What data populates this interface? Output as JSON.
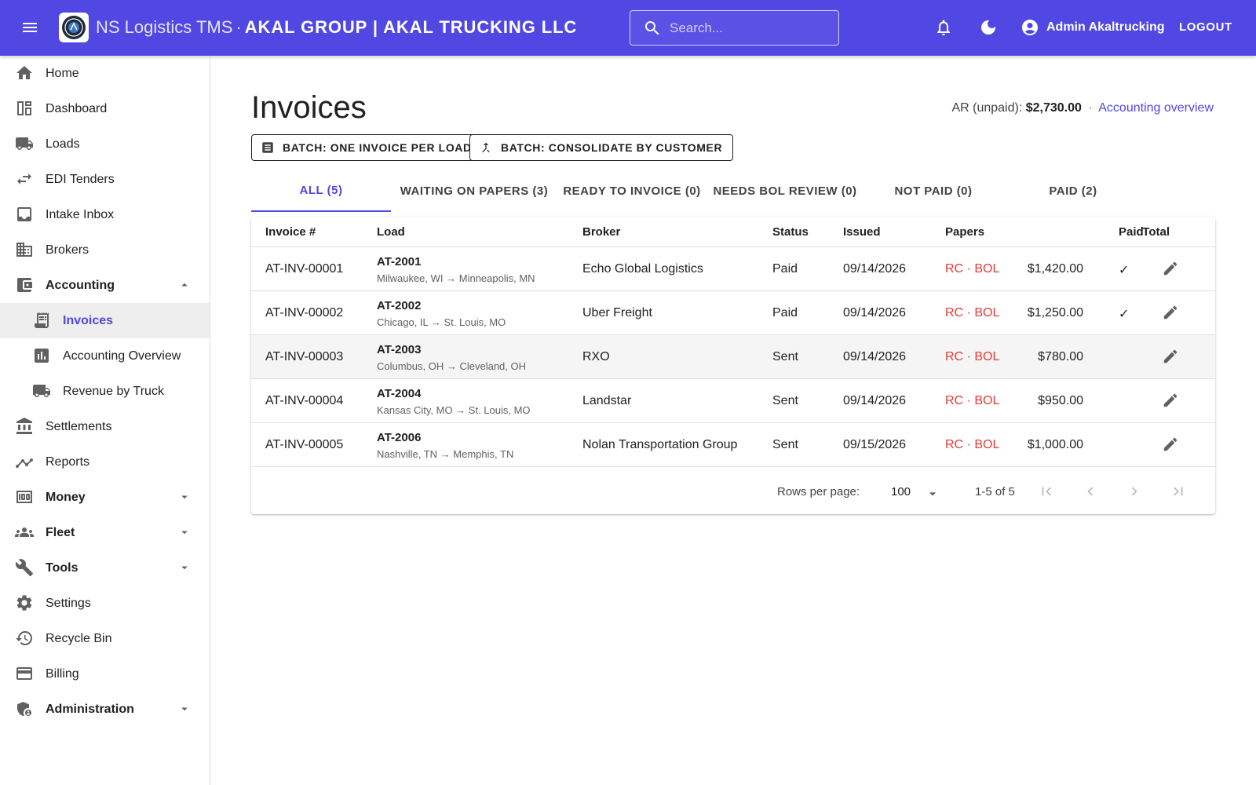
{
  "header": {
    "product": "NS Logistics TMS",
    "separator": "·",
    "company": "AKAL GROUP | AKAL TRUCKING LLC",
    "search_placeholder": "Search...",
    "user_name": "Admin Akaltrucking",
    "logout_label": "LOGOUT",
    "brand_color": "#5147e3"
  },
  "sidebar": {
    "home": "Home",
    "dashboard": "Dashboard",
    "loads": "Loads",
    "edi": "EDI Tenders",
    "intake": "Intake Inbox",
    "brokers": "Brokers",
    "accounting": "Accounting",
    "invoices": "Invoices",
    "accounting_overview": "Accounting Overview",
    "revenue_by_truck": "Revenue by Truck",
    "settlements": "Settlements",
    "reports": "Reports",
    "money": "Money",
    "fleet": "Fleet",
    "tools": "Tools",
    "settings": "Settings",
    "recycle_bin": "Recycle Bin",
    "billing": "Billing",
    "administration": "Administration"
  },
  "page": {
    "title": "Invoices",
    "ar_label": "AR (unpaid):",
    "ar_value": "$2,730.00",
    "ar_sep": "·",
    "ar_link": "Accounting overview",
    "batch_one": "BATCH: ONE INVOICE PER LOAD",
    "batch_consolidate": "BATCH: CONSOLIDATE BY CUSTOMER"
  },
  "tabs": {
    "all": "ALL (5)",
    "waiting": "WAITING ON PAPERS (3)",
    "ready": "READY TO INVOICE (0)",
    "bol": "NEEDS BOL REVIEW (0)",
    "not_paid": "NOT PAID (0)",
    "paid": "PAID (2)"
  },
  "table": {
    "headers": {
      "invoice": "Invoice #",
      "load": "Load",
      "broker": "Broker",
      "status": "Status",
      "issued": "Issued",
      "papers": "Papers",
      "total": "Total",
      "paid": "Paid"
    },
    "rows": [
      {
        "invoice": "AT-INV-00001",
        "load_id": "AT-2001",
        "route": "Milwaukee, WI → Minneapolis, MN",
        "broker": "Echo Global Logistics",
        "status": "Paid",
        "issued": "09/14/2026",
        "papers": "RC · BOL",
        "total": "$1,420.00",
        "paid": "✓"
      },
      {
        "invoice": "AT-INV-00002",
        "load_id": "AT-2002",
        "route": "Chicago, IL → St. Louis, MO",
        "broker": "Uber Freight",
        "status": "Paid",
        "issued": "09/14/2026",
        "papers": "RC · BOL",
        "total": "$1,250.00",
        "paid": "✓"
      },
      {
        "invoice": "AT-INV-00003",
        "load_id": "AT-2003",
        "route": "Columbus, OH → Cleveland, OH",
        "broker": "RXO",
        "status": "Sent",
        "issued": "09/14/2026",
        "papers": "RC · BOL",
        "total": "$780.00",
        "paid": ""
      },
      {
        "invoice": "AT-INV-00004",
        "load_id": "AT-2004",
        "route": "Kansas City, MO → St. Louis, MO",
        "broker": "Landstar",
        "status": "Sent",
        "issued": "09/14/2026",
        "papers": "RC · BOL",
        "total": "$950.00",
        "paid": ""
      },
      {
        "invoice": "AT-INV-00005",
        "load_id": "AT-2006",
        "route": "Nashville, TN → Memphis, TN",
        "broker": "Nolan Transportation Group",
        "status": "Sent",
        "issued": "09/15/2026",
        "papers": "RC · BOL",
        "total": "$1,000.00",
        "paid": ""
      }
    ]
  },
  "pagination": {
    "rows_label": "Rows per page:",
    "rows_value": "100",
    "range": "1-5 of 5"
  }
}
